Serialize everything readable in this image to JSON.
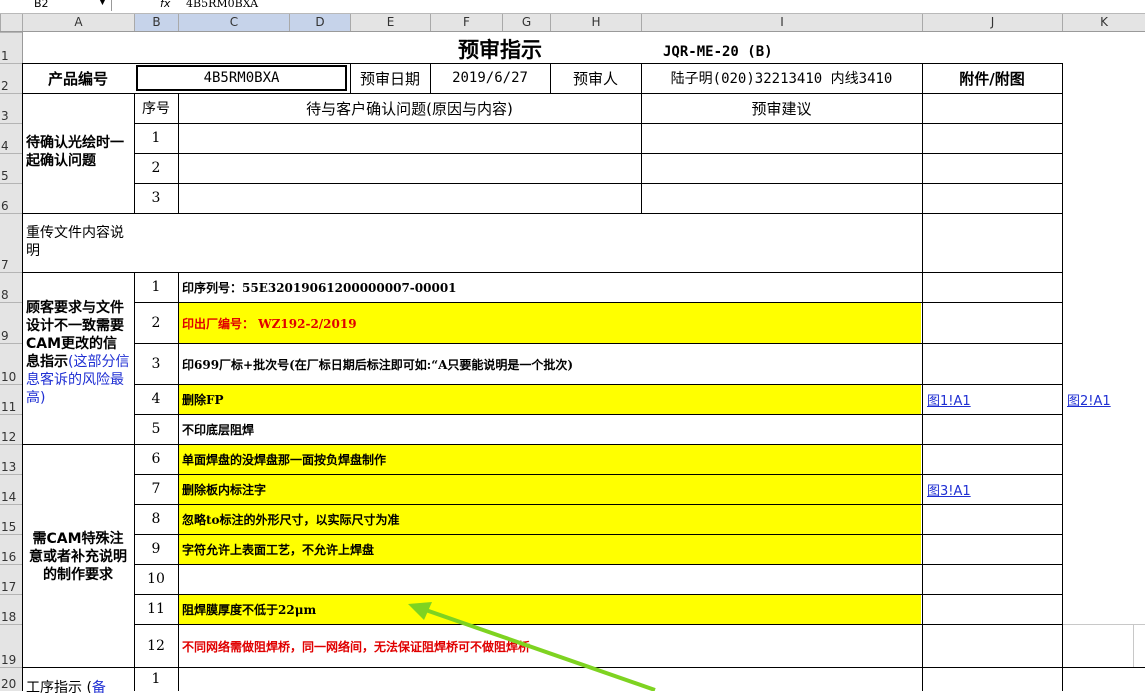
{
  "formula_bar": {
    "name_box": "B2",
    "fx": "fx",
    "formula": "4B5RM0BXA"
  },
  "columns": [
    "A",
    "B",
    "C",
    "D",
    "E",
    "F",
    "G",
    "H",
    "I",
    "J",
    "K"
  ],
  "rows": [
    "1",
    "2",
    "3",
    "4",
    "5",
    "6",
    "7",
    "8",
    "9",
    "10",
    "11",
    "12",
    "13",
    "14",
    "15",
    "16",
    "17",
    "18",
    "19",
    "20"
  ],
  "form": {
    "title": "预审指示",
    "code": "JQR-ME-20 (B)",
    "product_label": "产品编号",
    "product_value": "4B5RM0BXA",
    "date_label": "预审日期",
    "date_value": "2019/6/27",
    "reviewer_label": "预审人",
    "reviewer_value": "陆子明(020)32213410 内线3410",
    "attach_label": "附件/附图",
    "seq_header": "序号",
    "issue_header": "待与客户确认问题(原因与内容)",
    "suggest_header": "预审建议",
    "confirm_section": "待确认光绘时一起确认问题",
    "resend_section": "重传文件内容说明",
    "customer_section_a": "顾客要求与文件设计不一致需要CAM更改的信息指示",
    "customer_section_b": "(这部分信息客诉的风险最高)",
    "cam_section": "需CAM特殊注意或者补充说明的制作要求",
    "process_section_a": "工序指示 (",
    "process_section_b": "备",
    "confirm_rows": [
      "1",
      "2",
      "3"
    ],
    "customer_rows": [
      {
        "n": "1",
        "text": "印序列号：55E32019061200000007-00001"
      },
      {
        "n": "2",
        "text": "印出厂编号：  WZ192-2/2019"
      },
      {
        "n": "3",
        "text": "印699厂标+批次号(在厂标日期后标注即可如:“A只要能说明是一个批次)"
      },
      {
        "n": "4",
        "text": "删除FP",
        "link_j": "图1!A1",
        "link_k": "图2!A1"
      },
      {
        "n": "5",
        "text": "不印底层阻焊"
      }
    ],
    "cam_rows": [
      {
        "n": "6",
        "text": "单面焊盘的没焊盘那一面按负焊盘制作"
      },
      {
        "n": "7",
        "text": "删除板内标注字",
        "link_j": "图3!A1"
      },
      {
        "n": "8",
        "text": "忽略to标注的外形尺寸，以实际尺寸为准"
      },
      {
        "n": "9",
        "text": "字符允许上表面工艺，不允许上焊盘"
      },
      {
        "n": "10",
        "text": ""
      },
      {
        "n": "11",
        "text": "阻焊膜厚度不低于22μm"
      },
      {
        "n": "12",
        "text": "不同网络需做阻焊桥，同一网络间，无法保证阻焊桥可不做阻焊桥"
      }
    ],
    "process_rows": [
      "1"
    ]
  },
  "colors": {
    "highlight": "#ffff00",
    "arrow": "#7ed321",
    "link": "#1f2fd3",
    "alert": "#e00000"
  }
}
